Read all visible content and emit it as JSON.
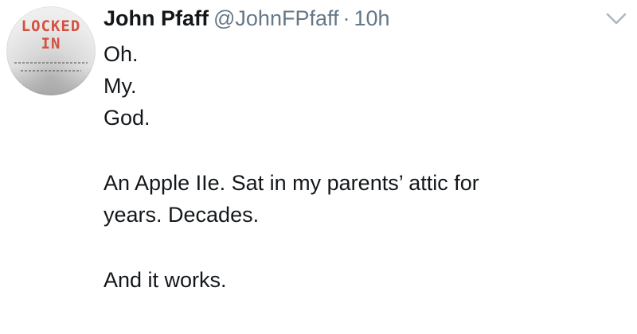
{
  "avatar": {
    "book_title_line1": "LOCKED",
    "book_title_line2": "IN",
    "accent_color": "#d4503f"
  },
  "header": {
    "display_name": "John Pfaff",
    "handle": "@JohnFPfaff",
    "separator": "·",
    "timestamp": "10h",
    "menu_icon": "chevron-down-icon"
  },
  "tweet": {
    "lines": [
      "Oh.",
      "My.",
      "God.",
      "An Apple IIe. Sat in my parents’ attic for",
      "years. Decades.",
      "And it works."
    ]
  }
}
